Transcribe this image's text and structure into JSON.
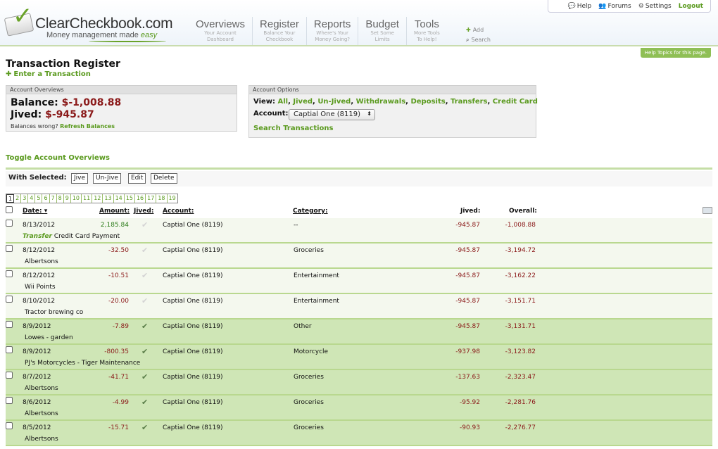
{
  "brand": {
    "name": "ClearCheckbook.com",
    "tagline_a": "Money management made",
    "tagline_b": "easy"
  },
  "nav": [
    {
      "title": "Overviews",
      "sub1": "Your Account",
      "sub2": "Dashboard"
    },
    {
      "title": "Register",
      "sub1": "Balance Your",
      "sub2": "Checkbook"
    },
    {
      "title": "Reports",
      "sub1": "Where's Your",
      "sub2": "Money Going?"
    },
    {
      "title": "Budget",
      "sub1": "Set Some",
      "sub2": "Limits"
    },
    {
      "title": "Tools",
      "sub1": "More Tools",
      "sub2": "To Help!"
    }
  ],
  "nav_extra": {
    "add": "Add",
    "search": "Search"
  },
  "toplinks": {
    "help": "Help",
    "forums": "Forums",
    "settings": "Settings",
    "logout": "Logout"
  },
  "help_topics": "Help Topics for this page.",
  "page": {
    "title": "Transaction Register",
    "enter": "Enter a Transaction"
  },
  "overview": {
    "header": "Account Overviews",
    "balance_label": "Balance:",
    "balance_value": "$-1,008.88",
    "jived_label": "Jived:",
    "jived_value": "$-945.87",
    "wrong_text": "Balances wrong?",
    "refresh": "Refresh Balances"
  },
  "options": {
    "header": "Account Options",
    "view_label": "View:",
    "views": [
      "All",
      "Jived",
      "Un-Jived",
      "Withdrawals",
      "Deposits",
      "Transfers",
      "Credit Card"
    ],
    "account_label": "Account:",
    "account_selected": "Captial One (8119)",
    "search": "Search Transactions"
  },
  "toggle_overviews": "Toggle Account Overviews",
  "with_selected": {
    "label": "With Selected:",
    "jive": "Jive",
    "unjive": "Un-Jive",
    "edit": "Edit",
    "delete": "Delete"
  },
  "pages": [
    "1",
    "2",
    "3",
    "4",
    "5",
    "6",
    "7",
    "8",
    "9",
    "10",
    "11",
    "12",
    "13",
    "14",
    "15",
    "16",
    "17",
    "18",
    "19"
  ],
  "current_page": "1",
  "columns": {
    "date": "Date:",
    "date_sort": "▾",
    "amount": "Amount:",
    "jived": "Jived:",
    "account": "Account:",
    "category": "Category:",
    "jived_bal": "Jived:",
    "overall": "Overall:"
  },
  "rows": [
    {
      "date": "8/13/2012",
      "amount": "2,185.84",
      "sign": "pos",
      "jived": false,
      "account": "Captial One (8119)",
      "category": "--",
      "jived_bal": "-945.87",
      "overall": "-1,008.88",
      "transfer": "Transfer",
      "desc": "Credit Card Payment"
    },
    {
      "date": "8/12/2012",
      "amount": "-32.50",
      "sign": "neg",
      "jived": false,
      "account": "Captial One (8119)",
      "category": "Groceries",
      "jived_bal": "-945.87",
      "overall": "-3,194.72",
      "transfer": "",
      "desc": "Albertsons"
    },
    {
      "date": "8/12/2012",
      "amount": "-10.51",
      "sign": "neg",
      "jived": false,
      "account": "Captial One (8119)",
      "category": "Entertainment",
      "jived_bal": "-945.87",
      "overall": "-3,162.22",
      "transfer": "",
      "desc": "Wii Points"
    },
    {
      "date": "8/10/2012",
      "amount": "-20.00",
      "sign": "neg",
      "jived": false,
      "account": "Captial One (8119)",
      "category": "Entertainment",
      "jived_bal": "-945.87",
      "overall": "-3,151.71",
      "transfer": "",
      "desc": "Tractor brewing co"
    },
    {
      "date": "8/9/2012",
      "amount": "-7.89",
      "sign": "neg",
      "jived": true,
      "account": "Captial One (8119)",
      "category": "Other",
      "jived_bal": "-945.87",
      "overall": "-3,131.71",
      "transfer": "",
      "desc": "Lowes - garden"
    },
    {
      "date": "8/9/2012",
      "amount": "-800.35",
      "sign": "neg",
      "jived": true,
      "account": "Captial One (8119)",
      "category": "Motorcycle",
      "jived_bal": "-937.98",
      "overall": "-3,123.82",
      "transfer": "",
      "desc": "PJ's Motorcycles - Tiger Maintenance"
    },
    {
      "date": "8/7/2012",
      "amount": "-41.71",
      "sign": "neg",
      "jived": true,
      "account": "Captial One (8119)",
      "category": "Groceries",
      "jived_bal": "-137.63",
      "overall": "-2,323.47",
      "transfer": "",
      "desc": "Albertsons"
    },
    {
      "date": "8/6/2012",
      "amount": "-4.99",
      "sign": "neg",
      "jived": true,
      "account": "Captial One (8119)",
      "category": "Groceries",
      "jived_bal": "-95.92",
      "overall": "-2,281.76",
      "transfer": "",
      "desc": "Albertsons"
    },
    {
      "date": "8/5/2012",
      "amount": "-15.71",
      "sign": "neg",
      "jived": true,
      "account": "Captial One (8119)",
      "category": "Groceries",
      "jived_bal": "-90.93",
      "overall": "-2,276.77",
      "transfer": "",
      "desc": "Albertsons"
    }
  ],
  "icons": {
    "check": "jived-check-icon",
    "folder": "folder-icon",
    "plus": "plus-icon"
  }
}
